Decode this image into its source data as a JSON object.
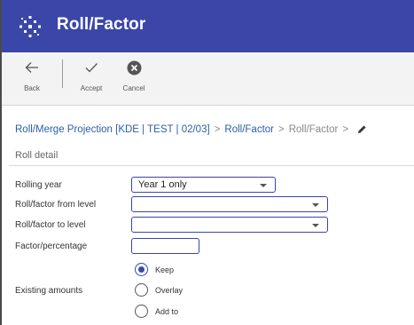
{
  "app": {
    "title": "Roll/Factor"
  },
  "toolbar": {
    "back_label": "Back",
    "accept_label": "Accept",
    "cancel_label": "Cancel"
  },
  "breadcrumb": {
    "items": [
      "Roll/Merge Projection [KDE | TEST | 02/03]",
      "Roll/Factor",
      "Roll/Factor"
    ],
    "separator": ">"
  },
  "section": {
    "title": "Roll detail"
  },
  "form": {
    "rolling_year": {
      "label": "Rolling year",
      "value": "Year 1 only"
    },
    "from_level": {
      "label": "Roll/factor from level",
      "value": ""
    },
    "to_level": {
      "label": "Roll/factor to level",
      "value": ""
    },
    "factor": {
      "label": "Factor/percentage",
      "value": ""
    },
    "existing_amounts": {
      "label": "Existing amounts",
      "options": [
        "Keep",
        "Overlay",
        "Add to"
      ],
      "selected": "Keep"
    }
  },
  "colors": {
    "header_bg": "#3a46a8",
    "link": "#2b5fa8",
    "accent": "#3a46a8"
  }
}
